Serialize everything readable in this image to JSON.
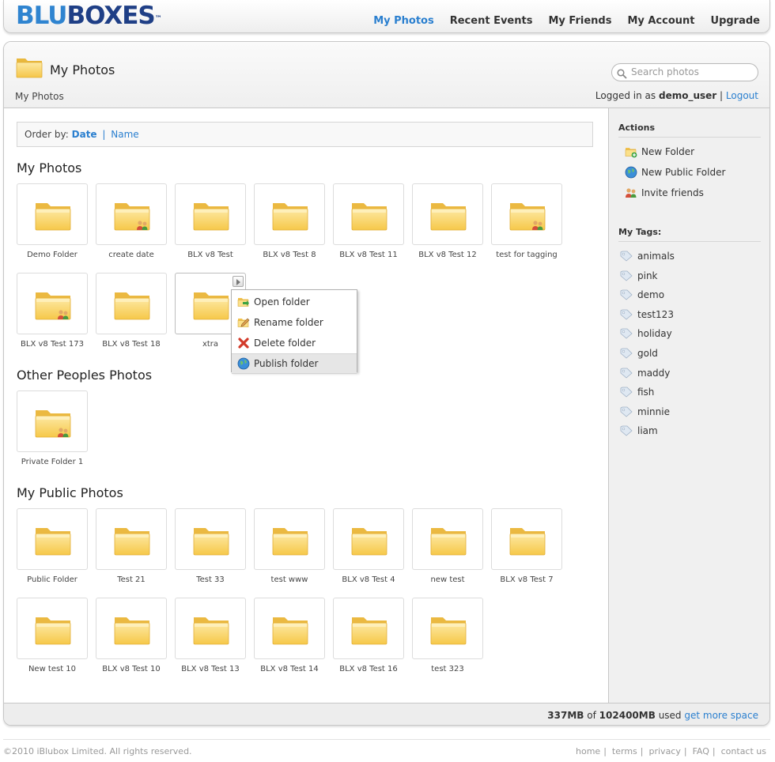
{
  "logo": {
    "blu": "BLU",
    "boxes": "BOXES",
    "tm": "™"
  },
  "nav": [
    "My Photos",
    "Recent Events",
    "My Friends",
    "My Account",
    "Upgrade"
  ],
  "header": {
    "title": "My Photos",
    "breadcrumb": "My Photos",
    "search_placeholder": "Search photos",
    "logged_in_prefix": "Logged in as",
    "username": "demo_user",
    "sep": "|",
    "logout": "Logout"
  },
  "order": {
    "label": "Order by:",
    "date": "Date",
    "sep": "|",
    "name": "Name"
  },
  "sections": {
    "my_photos": "My Photos",
    "other": "Other Peoples Photos",
    "public": "My Public Photos"
  },
  "my_photos": [
    {
      "name": "Demo Folder",
      "shared": false
    },
    {
      "name": "create date",
      "shared": true
    },
    {
      "name": "BLX v8 Test",
      "shared": false
    },
    {
      "name": "BLX v8 Test 8",
      "shared": false
    },
    {
      "name": "BLX v8 Test 11",
      "shared": false
    },
    {
      "name": "BLX v8 Test 12",
      "shared": false
    },
    {
      "name": "test for tagging",
      "shared": true
    },
    {
      "name": "BLX v8 Test 173",
      "shared": true
    },
    {
      "name": "BLX v8 Test 18",
      "shared": false
    },
    {
      "name": "xtra",
      "shared": false
    }
  ],
  "other_photos": [
    {
      "name": "Private Folder 1",
      "shared": true
    }
  ],
  "public_photos": [
    {
      "name": "Public Folder"
    },
    {
      "name": "Test 21"
    },
    {
      "name": "Test 33"
    },
    {
      "name": "test www"
    },
    {
      "name": "BLX v8 Test 4"
    },
    {
      "name": "new test"
    },
    {
      "name": "BLX v8 Test 7"
    },
    {
      "name": "New test 10"
    },
    {
      "name": "BLX v8 Test 10"
    },
    {
      "name": "BLX v8 Test 13"
    },
    {
      "name": "BLX v8 Test 14"
    },
    {
      "name": "BLX v8 Test 16"
    },
    {
      "name": "test 323"
    }
  ],
  "context_menu": [
    "Open folder",
    "Rename folder",
    "Delete folder",
    "Publish folder"
  ],
  "sidebar": {
    "actions_title": "Actions",
    "actions": [
      "New Folder",
      "New Public Folder",
      "Invite friends"
    ],
    "tags_title": "My Tags:",
    "tags": [
      "animals",
      "pink",
      "demo",
      "test123",
      "holiday",
      "gold",
      "maddy",
      "fish",
      "minnie",
      "liam"
    ]
  },
  "usage": {
    "used": "337MB",
    "of": "of",
    "total": "102400MB",
    "used_word": "used",
    "more": "get more space"
  },
  "footer": {
    "copyright": "©2010 iBlubox Limited. All rights reserved.",
    "links": [
      "home",
      "terms",
      "privacy",
      "FAQ",
      "contact us"
    ]
  },
  "colors": {
    "accent": "#2a7fcf",
    "logo_light": "#2f84d0",
    "logo_dark": "#1f3f86",
    "folder": "#f7cf5e"
  }
}
